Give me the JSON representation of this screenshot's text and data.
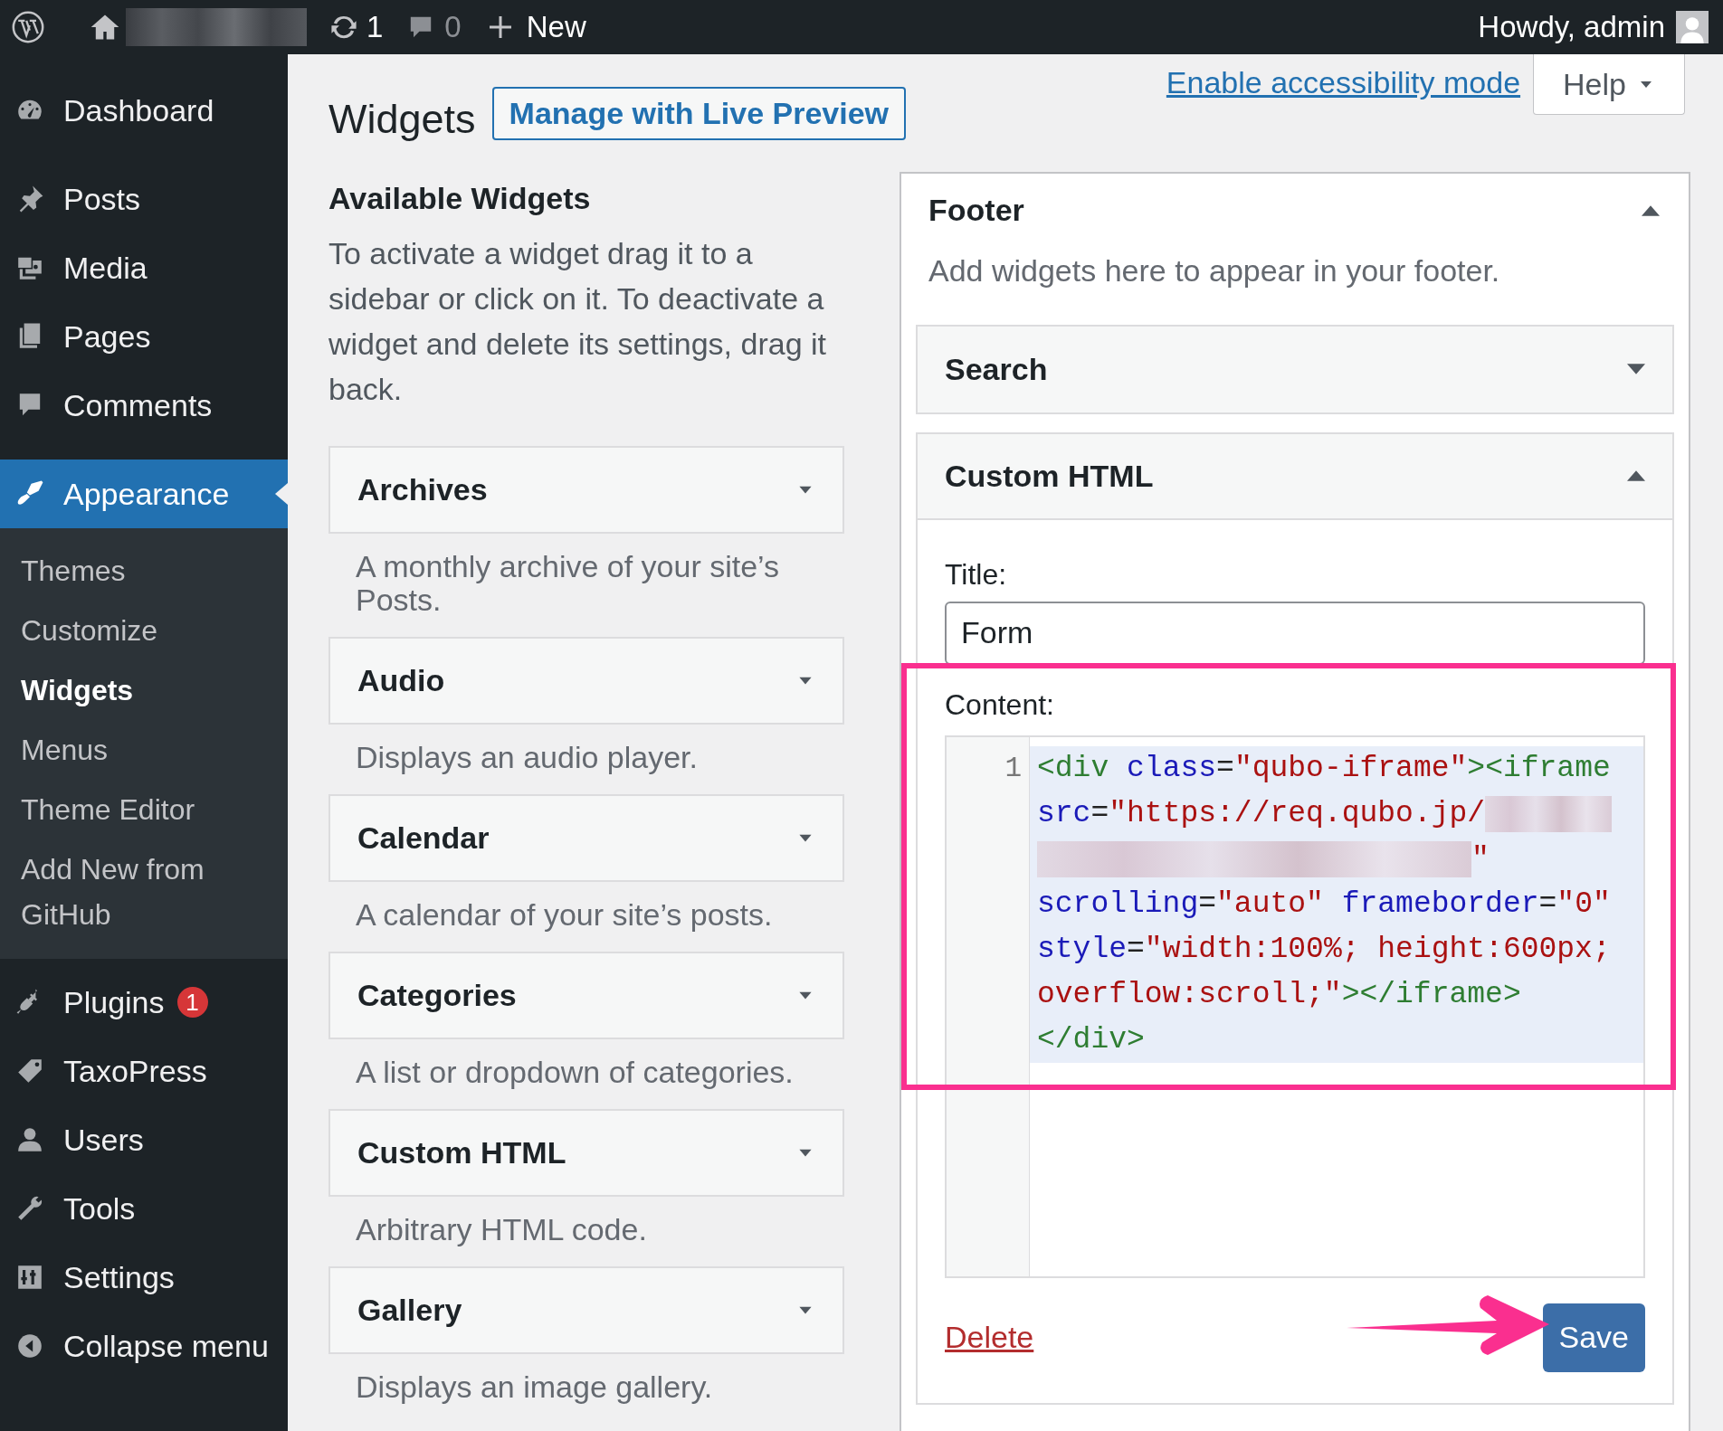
{
  "admin_bar": {
    "updates_count": "1",
    "comments_count": "0",
    "new_label": "New",
    "greeting": "Howdy, admin"
  },
  "sidebar": {
    "items": [
      {
        "label": "Dashboard",
        "selected": false
      },
      {
        "label": "Posts",
        "selected": false
      },
      {
        "label": "Media",
        "selected": false
      },
      {
        "label": "Pages",
        "selected": false
      },
      {
        "label": "Comments",
        "selected": false
      },
      {
        "label": "Appearance",
        "selected": true,
        "children": [
          {
            "label": "Themes",
            "selected": false
          },
          {
            "label": "Customize",
            "selected": false
          },
          {
            "label": "Widgets",
            "selected": true
          },
          {
            "label": "Menus",
            "selected": false
          },
          {
            "label": "Theme Editor",
            "selected": false
          },
          {
            "label": "Add New from GitHub",
            "selected": false
          }
        ]
      },
      {
        "label": "Plugins",
        "selected": false,
        "badge": "1"
      },
      {
        "label": "TaxoPress",
        "selected": false
      },
      {
        "label": "Users",
        "selected": false
      },
      {
        "label": "Tools",
        "selected": false
      },
      {
        "label": "Settings",
        "selected": false
      },
      {
        "label": "Collapse menu",
        "selected": false
      }
    ]
  },
  "header": {
    "title": "Widgets",
    "live_preview_button": "Manage with Live Preview",
    "accessibility_link": "Enable accessibility mode",
    "help_button": "Help"
  },
  "available_widgets": {
    "title": "Available Widgets",
    "description": "To activate a widget drag it to a sidebar or click on it. To deactivate a widget and delete its settings, drag it back.",
    "widgets": [
      {
        "name": "Archives",
        "description": "A monthly archive of your site’s Posts."
      },
      {
        "name": "Audio",
        "description": "Displays an audio player."
      },
      {
        "name": "Calendar",
        "description": "A calendar of your site’s posts."
      },
      {
        "name": "Categories",
        "description": "A list or dropdown of categories."
      },
      {
        "name": "Custom HTML",
        "description": "Arbitrary HTML code."
      },
      {
        "name": "Gallery",
        "description": "Displays an image gallery."
      }
    ]
  },
  "footer_area": {
    "title": "Footer",
    "expanded": true,
    "description": "Add widgets here to appear in your footer.",
    "widgets": [
      {
        "name": "Search",
        "expanded": false
      },
      {
        "name": "Custom HTML",
        "expanded": true,
        "title_label": "Title:",
        "title_value": "Form",
        "content_label": "Content:",
        "code": {
          "line_number": "1",
          "lines": [
            {
              "tokens": [
                {
                  "kind": "tag",
                  "text": "<div "
                },
                {
                  "kind": "attr",
                  "text": "class"
                },
                {
                  "kind": "punct",
                  "text": "="
                },
                {
                  "kind": "string",
                  "text": "\"qubo-iframe\""
                },
                {
                  "kind": "tag",
                  "text": "><iframe"
                }
              ]
            },
            {
              "tokens": [
                {
                  "kind": "attr",
                  "text": "src"
                },
                {
                  "kind": "punct",
                  "text": "="
                },
                {
                  "kind": "string",
                  "text": "\"https://req.qubo.jp/"
                },
                {
                  "kind": "redacted"
                }
              ]
            },
            {
              "tokens": [
                {
                  "kind": "redacted"
                },
                {
                  "kind": "string",
                  "text": "\""
                }
              ]
            },
            {
              "tokens": [
                {
                  "kind": "attr",
                  "text": "scrolling"
                },
                {
                  "kind": "punct",
                  "text": "="
                },
                {
                  "kind": "string",
                  "text": "\"auto\" "
                },
                {
                  "kind": "attr",
                  "text": "frameborder"
                },
                {
                  "kind": "punct",
                  "text": "="
                },
                {
                  "kind": "string",
                  "text": "\"0\""
                }
              ]
            },
            {
              "tokens": [
                {
                  "kind": "attr",
                  "text": "style"
                },
                {
                  "kind": "punct",
                  "text": "="
                },
                {
                  "kind": "string",
                  "text": "\"width:100%; height:600px;"
                }
              ]
            },
            {
              "tokens": [
                {
                  "kind": "string",
                  "text": "overflow:scroll;\""
                },
                {
                  "kind": "tag",
                  "text": "></iframe>"
                }
              ]
            },
            {
              "tokens": [
                {
                  "kind": "tag",
                  "text": "</div>"
                }
              ]
            }
          ]
        },
        "delete_link": "Delete",
        "save_button": "Save"
      }
    ]
  }
}
